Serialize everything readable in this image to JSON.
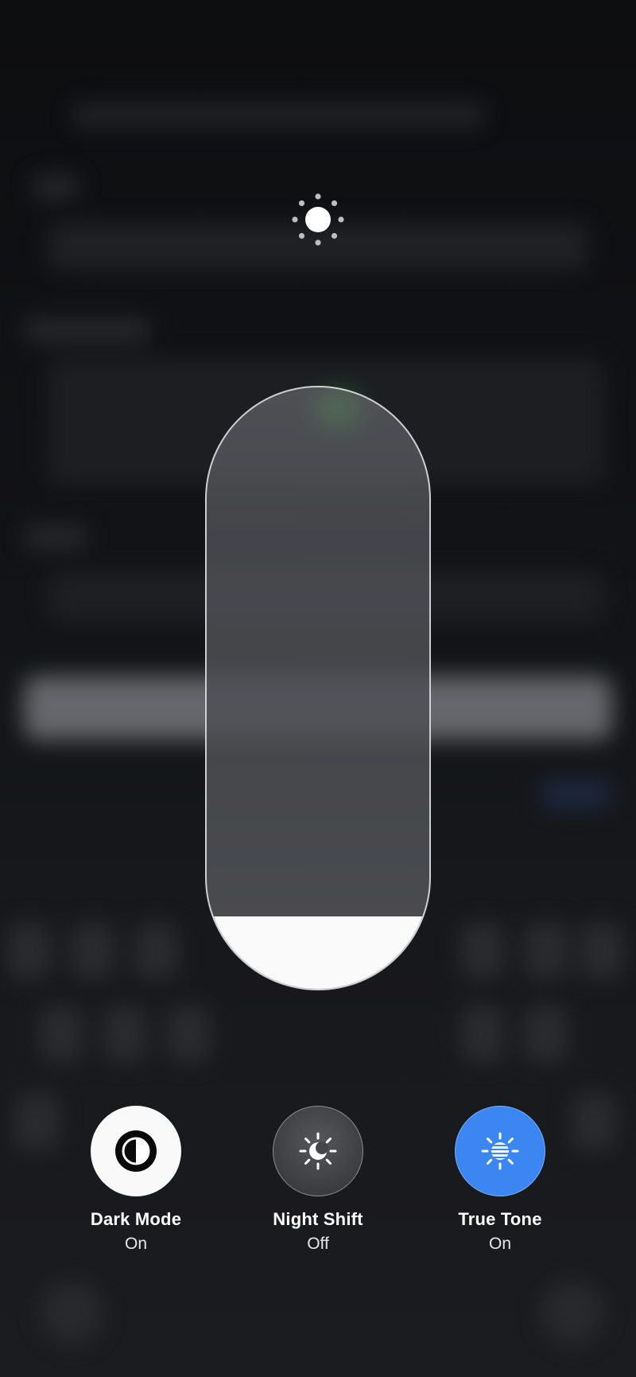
{
  "brightness": {
    "icon": "sun-brightness-icon",
    "level": 0.12
  },
  "controls": [
    {
      "label": "Dark Mode",
      "state": "On",
      "icon": "dark-mode-icon"
    },
    {
      "label": "Night Shift",
      "state": "Off",
      "icon": "night-shift-icon"
    },
    {
      "label": "True Tone",
      "state": "On",
      "icon": "true-tone-icon"
    }
  ],
  "colors": {
    "true_tone_active": "#3b86f0",
    "dark_mode_active": "#f9f9f9",
    "slider_fill": "#fafafa"
  }
}
